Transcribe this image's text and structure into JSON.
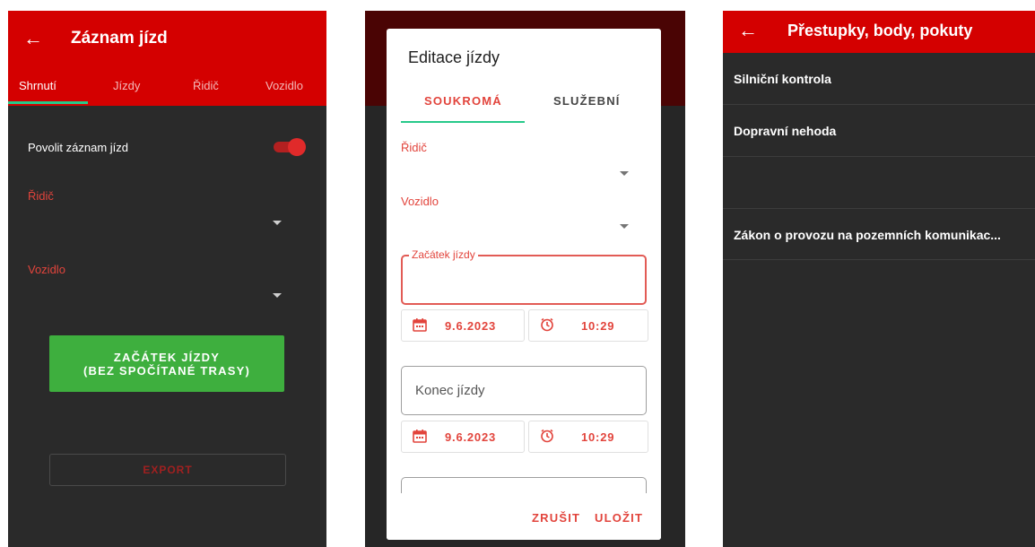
{
  "screen1": {
    "title": "Záznam jízd",
    "tabs": [
      "Shrnutí",
      "Jízdy",
      "Řidič",
      "Vozidlo"
    ],
    "toggle_label": "Povolit záznam jízd",
    "toggle_on": true,
    "driver_label": "Řidič",
    "vehicle_label": "Vozidlo",
    "start_button_line1": "ZAČÁTEK JÍZDY",
    "start_button_line2": "(BEZ SPOČÍTANÉ TRASY)",
    "export_label": "EXPORT",
    "colors": {
      "appbar": "#d40000",
      "accent": "#27c98a",
      "button": "#3eaf3e"
    }
  },
  "screen2": {
    "dialog_title": "Editace jízdy",
    "tabs": [
      "SOUKROMÁ",
      "SLUŽEBNÍ"
    ],
    "driver_label": "Řidič",
    "vehicle_label": "Vozidlo",
    "start_field_label": "Začátek jízdy",
    "start_date": "9.6.2023",
    "start_time": "10:29",
    "end_field_placeholder": "Konec jízdy",
    "end_date": "9.6.2023",
    "end_time": "10:29",
    "cancel_label": "ZRUŠIT",
    "save_label": "ULOŽIT"
  },
  "screen3": {
    "title": "Přestupky, body, pokuty",
    "items": [
      "Silniční kontrola",
      "Dopravní nehoda",
      "",
      "Zákon o provozu na pozemních komunikac..."
    ]
  }
}
